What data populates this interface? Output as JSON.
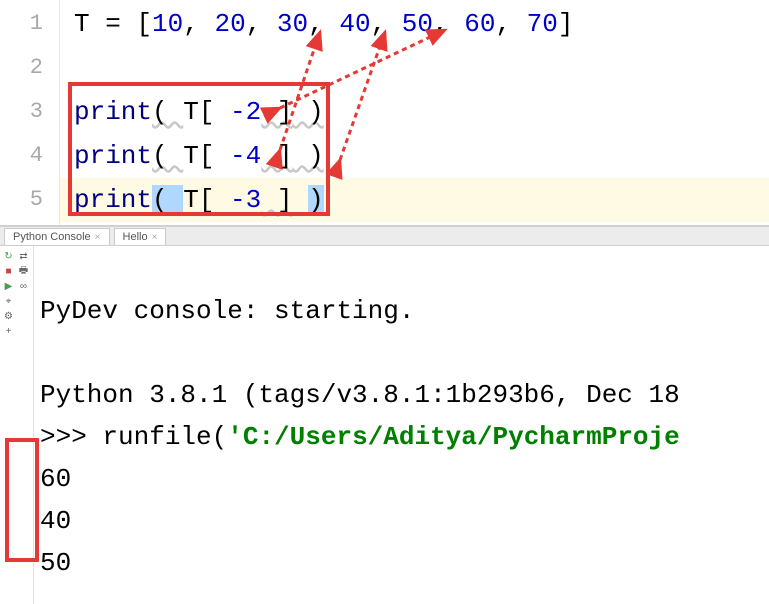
{
  "editor": {
    "gutter": [
      "1",
      "2",
      "3",
      "4",
      "5"
    ],
    "line1": {
      "var": "T",
      "eq": " = [",
      "nums": [
        "10",
        "20",
        "30",
        "40",
        "50",
        "60",
        "70"
      ],
      "close": "]"
    },
    "line3": {
      "fn": "print",
      "open": "( ",
      "var": "T[ ",
      "idx": "-2",
      "close_idx": " ]",
      "close": " )"
    },
    "line4": {
      "fn": "print",
      "open": "( ",
      "var": "T[ ",
      "idx": "-4",
      "close_idx": " ]",
      "close": " )"
    },
    "line5": {
      "fn": "print",
      "open": "( ",
      "var": "T[ ",
      "idx": "-3",
      "close_idx": " ]",
      "close": " )"
    }
  },
  "tabs": {
    "t1": "Python Console",
    "t2": "Hello"
  },
  "console": {
    "start": "PyDev console: starting.",
    "version": "Python 3.8.1 (tags/v3.8.1:1b293b6, Dec 18",
    "prompt": ">>> ",
    "runfile": "runfile(",
    "path": "'C:/Users/Aditya/PycharmProje",
    "out": [
      "60",
      "40",
      "50"
    ]
  },
  "icons": {
    "rerun": "↻",
    "stop": "■",
    "play": "▶",
    "print": "🖶",
    "bug": "⌖",
    "link": "∞",
    "gear": "⚙",
    "plus": "+"
  }
}
